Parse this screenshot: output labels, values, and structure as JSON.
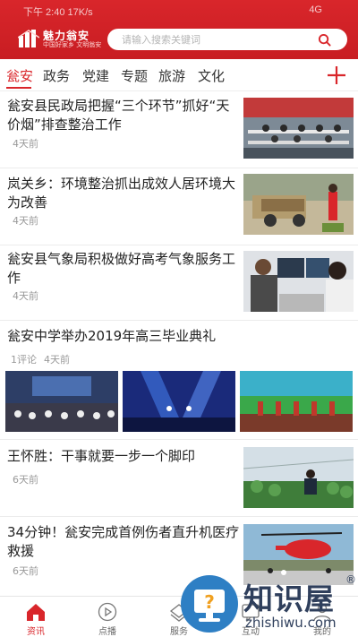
{
  "status": {
    "left": "下午 2:40  17K/s",
    "right": "4G"
  },
  "logo": {
    "name": "魅力翁安",
    "slogan": "中国好家乡 文明翁安"
  },
  "search": {
    "placeholder": "请输入搜索关键词"
  },
  "tabs": [
    {
      "label": "瓮安",
      "active": true
    },
    {
      "label": "政务"
    },
    {
      "label": "党建"
    },
    {
      "label": "专题"
    },
    {
      "label": "旅游"
    },
    {
      "label": "文化"
    }
  ],
  "news": [
    {
      "title": "瓮安县民政局把握“三个环节”抓好“天价烟”排查整治工作",
      "time": "4天前"
    },
    {
      "title": "岚关乡：环境整治抓出成效人居环境大为改善",
      "time": "4天前"
    },
    {
      "title": "瓮安县气象局积极做好高考气象服务工作",
      "time": "4天前"
    },
    {
      "title": "瓮安中学举办2019年高三毕业典礼",
      "comments": "1评论",
      "time": "4天前"
    },
    {
      "title": "王怀胜：干事就要一步一个脚印",
      "time": "6天前"
    },
    {
      "title": "34分钟！瓮安完成首例伤者直升机医疗救援",
      "time": "6天前"
    }
  ],
  "bottom_nav": [
    {
      "label": "资讯",
      "icon": "home-icon",
      "active": true
    },
    {
      "label": "点播",
      "icon": "play-icon"
    },
    {
      "label": "服务",
      "icon": "service-icon"
    },
    {
      "label": "互动",
      "icon": "interact-icon"
    },
    {
      "label": "我的",
      "icon": "user-icon"
    }
  ],
  "watermark": {
    "text": "知识屋",
    "url": "zhishiwu.com",
    "mark": "®"
  },
  "colors": {
    "brand": "#d9262b",
    "muted": "#999999"
  }
}
